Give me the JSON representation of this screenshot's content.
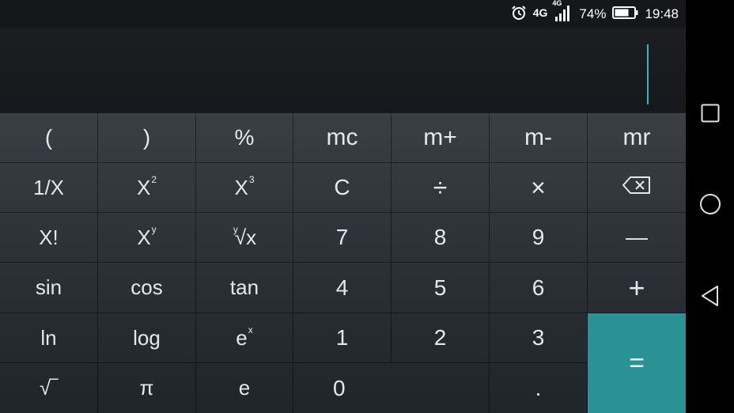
{
  "status": {
    "alarm_icon": "alarm-clock-icon",
    "network_small": "4G",
    "network_large": "4G",
    "signal_icon": "signal-bars-icon",
    "battery_percent": "74%",
    "battery_icon": "battery-icon",
    "battery_level": 0.74,
    "time": "19:48"
  },
  "display": {
    "expression": "",
    "cursor_color": "#2fb7c4"
  },
  "keys": {
    "paren_open": "(",
    "paren_close": ")",
    "percent": "%",
    "mc": "mc",
    "m_plus": "m+",
    "m_minus": "m-",
    "mr": "mr",
    "reciprocal": "1/X",
    "square_base": "X",
    "square_exp": "2",
    "cube_base": "X",
    "cube_exp": "3",
    "clear": "C",
    "divide": "÷",
    "multiply": "×",
    "backspace_icon": "backspace-icon",
    "factorial": "X!",
    "power_base": "X",
    "power_exp": "y",
    "root_y_index": "y",
    "root_y_radicand": "√x",
    "seven": "7",
    "eight": "8",
    "nine": "9",
    "minus": "—",
    "sin": "sin",
    "cos": "cos",
    "tan": "tan",
    "four": "4",
    "five": "5",
    "six": "6",
    "plus": "+",
    "ln": "ln",
    "log": "log",
    "exp_base": "e",
    "exp_exp": "x",
    "one": "1",
    "two": "2",
    "three": "3",
    "equals": "=",
    "sqrt": "√‾",
    "pi": "π",
    "e": "e",
    "zero": "0",
    "decimal": "."
  },
  "navbar": {
    "recents_icon": "square-recents-icon",
    "home_icon": "circle-home-icon",
    "back_icon": "triangle-back-icon"
  },
  "colors": {
    "accent_equals": "#2a9294",
    "display_bg": "#16181b"
  }
}
